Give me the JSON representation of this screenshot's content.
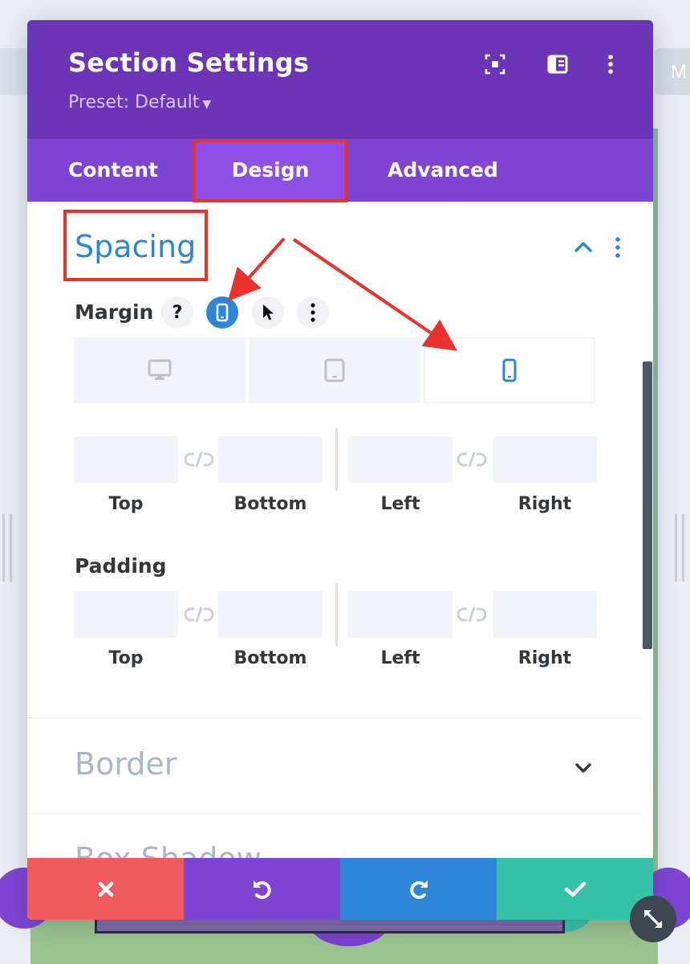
{
  "background": {
    "right_tab_text": "M"
  },
  "modal": {
    "title": "Section Settings",
    "preset_label": "Preset: Default",
    "header_icons": [
      "fullscreen-icon",
      "sidebar-layout-icon",
      "more-vertical-icon"
    ],
    "tabs": [
      {
        "label": "Content",
        "active": false
      },
      {
        "label": "Design",
        "active": true
      },
      {
        "label": "Advanced",
        "active": false
      }
    ]
  },
  "spacing": {
    "title": "Spacing",
    "expanded": true,
    "margin": {
      "label": "Margin",
      "help_symbol": "?",
      "device_tabs": [
        {
          "name": "desktop",
          "active": false
        },
        {
          "name": "tablet",
          "active": false
        },
        {
          "name": "phone",
          "active": true
        }
      ],
      "fields": {
        "top": "",
        "bottom": "",
        "left": "",
        "right": ""
      },
      "labels": {
        "top": "Top",
        "bottom": "Bottom",
        "left": "Left",
        "right": "Right"
      }
    },
    "padding": {
      "label": "Padding",
      "fields": {
        "top": "",
        "bottom": "",
        "left": "",
        "right": ""
      },
      "labels": {
        "top": "Top",
        "bottom": "Bottom",
        "left": "Left",
        "right": "Right"
      }
    }
  },
  "collapsed_sections": [
    {
      "title": "Border"
    },
    {
      "title": "Box Shadow"
    }
  ],
  "footer": {
    "buttons": [
      {
        "name": "cancel",
        "icon": "close-icon",
        "color": "#ef5a5a"
      },
      {
        "name": "undo",
        "icon": "undo-icon",
        "color": "#7e45d3"
      },
      {
        "name": "redo",
        "icon": "redo-icon",
        "color": "#2e86d8"
      },
      {
        "name": "save",
        "icon": "check-icon",
        "color": "#34c3a7"
      }
    ]
  },
  "colors": {
    "header": "#6c35b8",
    "tabs": "#7e45d3",
    "active_tab": "#8d4fe6",
    "accent_blue": "#2e86d8",
    "annotation_red": "#e8322b"
  }
}
